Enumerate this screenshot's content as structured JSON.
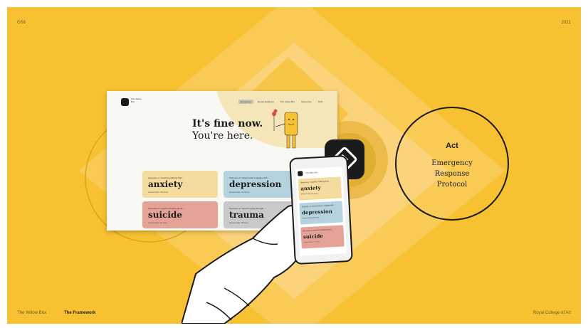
{
  "slide": {
    "tag": "GS6",
    "year": "2021",
    "project": "The Yellow Box",
    "section": "The Framework",
    "institution": "Royal College of Art"
  },
  "website": {
    "logo_text": "The Yellow Box",
    "nav": [
      "Emergency",
      "Mental Wellbeing",
      "The Yellow Box",
      "Resources",
      "SOS"
    ],
    "hero_line1": "It's fine now.",
    "hero_line2": "You're here.",
    "cards": [
      {
        "pre": "Someone or myself is suffering from...",
        "word": "anxiety",
        "view": "Viewed today: 220 times",
        "color": "#F5DC9E"
      },
      {
        "pre": "Someone or myself today is dealing with...",
        "word": "depression",
        "view": "Viewed today: 162 times",
        "color": "#B4D3DF"
      },
      {
        "pre": "Someone or myself is thinking about...",
        "word": "suicide",
        "view": "Viewed today: 37 times",
        "color": "#E7A297"
      },
      {
        "pre": "Someone or myself is going through...",
        "word": "trauma",
        "view": "Viewed today: 85 times",
        "color": "#C9C9C9"
      }
    ]
  },
  "phone": {
    "nav": "The Yellow Box",
    "cards": [
      {
        "pre": "Someone or myself is suffering from...",
        "word": "anxiety",
        "view": "Viewed today: 220 times",
        "color": "#F5DC9E"
      },
      {
        "pre": "Someone or myself today is dealing with...",
        "word": "depression",
        "view": "Viewed today: 162 times",
        "color": "#B4D3DF"
      },
      {
        "pre": "Someone or myself is thinking about...",
        "word": "suicide",
        "view": "Viewed today: 37 times",
        "color": "#E7A297"
      }
    ]
  },
  "act_panel": {
    "title": "Act",
    "line1": "Emergency",
    "line2": "Response",
    "line3": "Protocol"
  }
}
